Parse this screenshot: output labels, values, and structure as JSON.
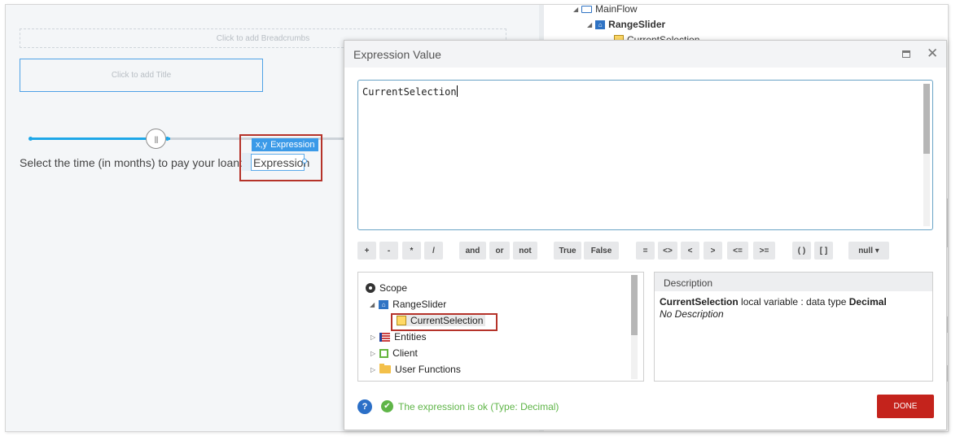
{
  "canvas": {
    "breadcrumbs_placeholder": "Click to add Breadcrumbs",
    "title_placeholder": "Click to add Title",
    "slider": {
      "value_fraction": 0.43
    },
    "loan_label": "Select the time (in months) to pay your loan:",
    "expression_tag": {
      "icon": "x,y",
      "label": "Expression"
    },
    "expression_widget_text": "Expression"
  },
  "tree": {
    "main_flow": "MainFlow",
    "range_slider": "RangeSlider",
    "current_selection": "CurrentSelection"
  },
  "dialog": {
    "title": "Expression Value",
    "expression_text": "CurrentSelection",
    "operators": [
      "+",
      "-",
      "*",
      "/",
      "and",
      "or",
      "not",
      "True",
      "False",
      "=",
      "<>",
      "<",
      ">",
      "<=",
      ">=",
      "( )",
      "[ ]",
      "null ▾"
    ],
    "scope": {
      "root": "Scope",
      "items": [
        "RangeSlider",
        "CurrentSelection",
        "Entities",
        "Client",
        "User Functions"
      ]
    },
    "description": {
      "header": "Description",
      "name": "CurrentSelection",
      "middle": " local variable : data type ",
      "type": "Decimal",
      "note": "No Description"
    },
    "help_label": "?",
    "status": "The expression is ok (Type: Decimal)",
    "done_label": "DONE"
  },
  "colors": {
    "accent": "#3b9ae8",
    "ok": "#5fb548",
    "done": "#c4231c",
    "highlight": "#b5332a"
  }
}
